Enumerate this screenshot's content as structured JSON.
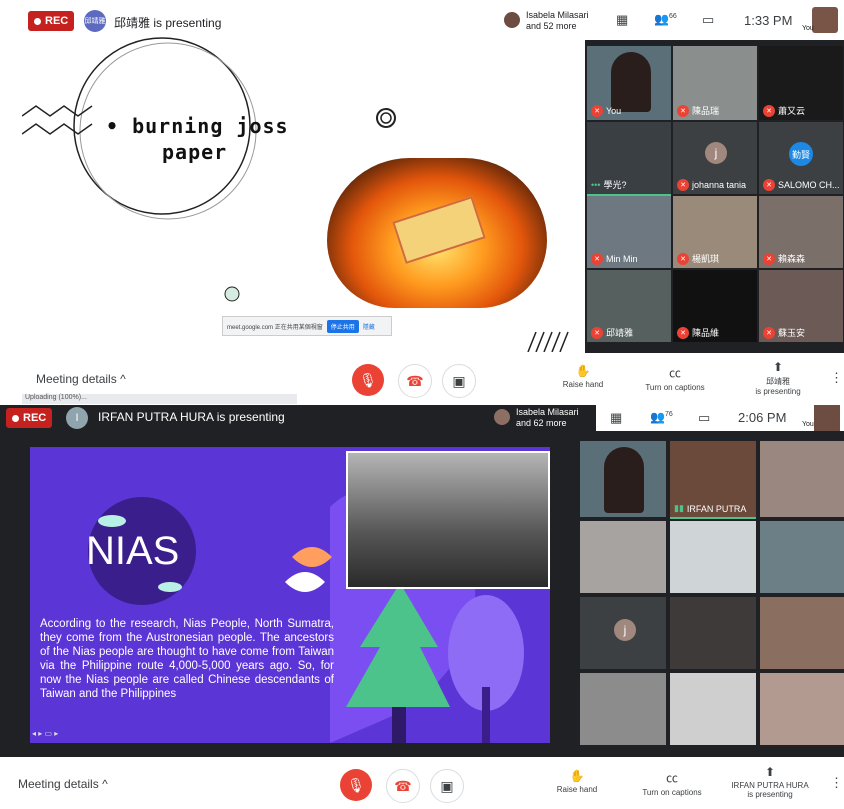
{
  "top": {
    "rec_label": "REC",
    "presenter_avatar": "邱靖雅",
    "presenter_status": "邱靖雅 is presenting",
    "participants_preview_name": "Isabela Milasari",
    "participants_preview_more": "and 52 more",
    "people_count": "66",
    "time": "1:33 PM",
    "self_label": "You",
    "slide": {
      "title_line1": "• burning joss",
      "title_line2": "paper",
      "share_notice": "meet.google.com 正在共用某個視窗",
      "share_stop": "停止共用",
      "share_hide": "隱藏"
    },
    "tiles": [
      {
        "name": "You",
        "avatar": ""
      },
      {
        "name": "陳品瑞",
        "avatar": ""
      },
      {
        "name": "蕭又云",
        "avatar": ""
      },
      {
        "name": "學光?",
        "avatar": ""
      },
      {
        "name": "johanna tania",
        "avatar": "j"
      },
      {
        "name": "SALOMO CH...",
        "avatar": "勤賢"
      },
      {
        "name": "Min Min",
        "avatar": ""
      },
      {
        "name": "楊凱琪",
        "avatar": ""
      },
      {
        "name": "賴森森",
        "avatar": ""
      },
      {
        "name": "邱靖雅",
        "avatar": ""
      },
      {
        "name": "陳品維",
        "avatar": ""
      },
      {
        "name": "蘇玉安",
        "avatar": ""
      }
    ],
    "bottom": {
      "meeting_details": "Meeting details",
      "uploading": "Uploading (100%)...",
      "raise_hand": "Raise hand",
      "captions": "Turn on captions",
      "presenting_name": "邱靖雅",
      "presenting_label": "is presenting"
    }
  },
  "bottom_panel": {
    "rec_label": "REC",
    "presenter_initial": "I",
    "presenter_status": "IRFAN PUTRA HURA is presenting",
    "participants_preview_name": "Isabela Milasari",
    "participants_preview_more": "and 62 more",
    "people_count": "76",
    "time": "2:06 PM",
    "self_label": "You",
    "slide": {
      "title": "NIAS",
      "body": "According to the research, Nias People, North Sumatra, they come from the Austronesian people. The ancestors of the Nias people are thought to have come from Taiwan via the Philippine route 4,000-5,000 years ago. So, for now the Nias people are called Chinese descendants of Taiwan and the Philippines"
    },
    "tiles": [
      {
        "name": "",
        "avatar": ""
      },
      {
        "name": "IRFAN PUTRA",
        "avatar": ""
      },
      {
        "name": "",
        "avatar": ""
      },
      {
        "name": "",
        "avatar": ""
      },
      {
        "name": "",
        "avatar": ""
      },
      {
        "name": "",
        "avatar": ""
      },
      {
        "name": "",
        "avatar": "j"
      },
      {
        "name": "",
        "avatar": ""
      },
      {
        "name": "",
        "avatar": ""
      },
      {
        "name": "",
        "avatar": ""
      },
      {
        "name": "",
        "avatar": ""
      },
      {
        "name": "",
        "avatar": ""
      }
    ],
    "bottom": {
      "meeting_details": "Meeting details",
      "raise_hand": "Raise hand",
      "captions": "Turn on captions",
      "presenting_name": "IRFAN PUTRA HURA",
      "presenting_label": "is presenting"
    }
  },
  "colors": {
    "rec": "#c5221f",
    "end_call": "#ea4335",
    "slide2_bg": "#5b35d5",
    "tree": "#4cc38a"
  }
}
